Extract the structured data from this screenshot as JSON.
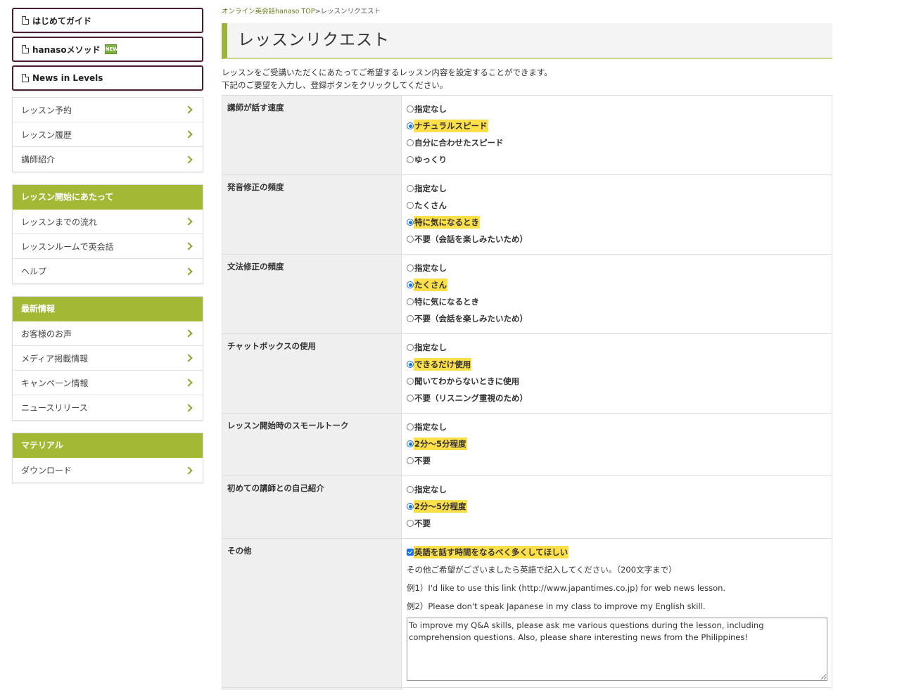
{
  "sidebar": {
    "guides": [
      {
        "label": "はじめてガイド",
        "badge": null
      },
      {
        "label": "hanasoメソッド",
        "badge": "NEW"
      },
      {
        "label": "News in Levels",
        "badge": null
      }
    ],
    "menu": [
      "レッスン予約",
      "レッスン履歴",
      "講師紹介"
    ],
    "groups": [
      {
        "title": "レッスン開始にあたって",
        "items": [
          "レッスンまでの流れ",
          "レッスンルームで英会話",
          "ヘルプ"
        ]
      },
      {
        "title": "最新情報",
        "items": [
          "お客様のお声",
          "メディア掲載情報",
          "キャンペーン情報",
          "ニュースリリース"
        ]
      },
      {
        "title": "マテリアル",
        "items": [
          "ダウンロード"
        ]
      }
    ]
  },
  "breadcrumb": {
    "home": "オンライン英会話hanaso TOP",
    "separator": ">",
    "current": "レッスンリクエスト"
  },
  "page_title": "レッスンリクエスト",
  "intro": {
    "line1": "レッスンをご受講いただくにあたってご希望するレッスン内容を設定することができます。",
    "line2": "下記のご要望を入力し、登録ボタンをクリックしてください。"
  },
  "rows": [
    {
      "label": "講師が話す速度",
      "options": [
        "指定なし",
        "ナチュラルスピード",
        "自分に合わせたスピード",
        "ゆっくり"
      ],
      "selected": 1
    },
    {
      "label": "発音修正の頻度",
      "options": [
        "指定なし",
        "たくさん",
        "特に気になるとき",
        "不要（会話を楽しみたいため）"
      ],
      "selected": 2
    },
    {
      "label": "文法修正の頻度",
      "options": [
        "指定なし",
        "たくさん",
        "特に気になるとき",
        "不要（会話を楽しみたいため）"
      ],
      "selected": 1
    },
    {
      "label": "チャットボックスの使用",
      "options": [
        "指定なし",
        "できるだけ使用",
        "聞いてわからないときに使用",
        "不要（リスニング重視のため）"
      ],
      "selected": 1
    },
    {
      "label": "レッスン開始時のスモールトーク",
      "options": [
        "指定なし",
        "2分〜5分程度",
        "不要"
      ],
      "selected": 1
    },
    {
      "label": "初めての講師との自己紹介",
      "options": [
        "指定なし",
        "2分〜5分程度",
        "不要"
      ],
      "selected": 1
    }
  ],
  "other": {
    "label": "その他",
    "checkbox_label": "英語を話す時間をなるべく多くしてほしい",
    "checked": true,
    "instruction": "その他ご希望がございましたら英語で記入してください。（200文字まで）",
    "example1": "例1）I'd like to use this link (http://www.japantimes.co.jp) for web news lesson.",
    "example2": "例2）Please don't speak Japanese in my class to improve my English skill.",
    "text": "To improve my Q&A skills, please ask me various questions during the lesson, including comprehension questions. Also, please share interesting news from the Philippines!"
  },
  "colors": {
    "accent": "#a3b935",
    "guide_border": "#4a1d35",
    "highlight": "#fddf4a",
    "radio": "#1a73e8"
  }
}
